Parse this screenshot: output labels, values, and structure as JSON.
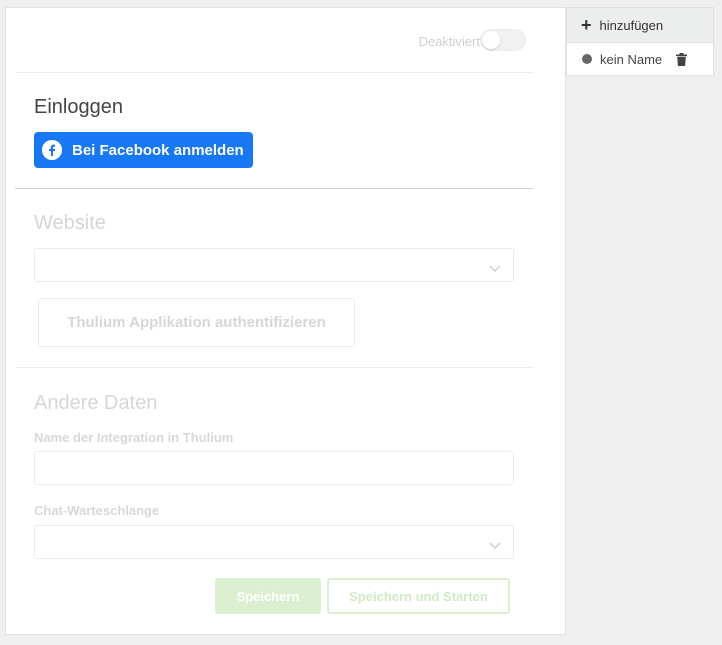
{
  "toggle": {
    "label": "Deaktiviert",
    "state": "off"
  },
  "login": {
    "heading": "Einloggen",
    "facebook_button": "Bei Facebook anmelden",
    "facebook_color": "#1877f2"
  },
  "website": {
    "heading": "Website",
    "select_value": "",
    "auth_button": "Thulium Applikation authentifizieren"
  },
  "other": {
    "heading": "Andere Daten",
    "integration_name_label": "Name der Integration in Thulium",
    "integration_name_value": "",
    "chat_queue_label": "Chat-Warteschlange",
    "chat_queue_value": ""
  },
  "actions": {
    "save": "Speichern",
    "save_and_start": "Speichern und Starten",
    "accent": "#dcefd1"
  },
  "sidebar": {
    "add_label": "hinzufügen",
    "items": [
      {
        "label": "kein Name"
      }
    ]
  }
}
